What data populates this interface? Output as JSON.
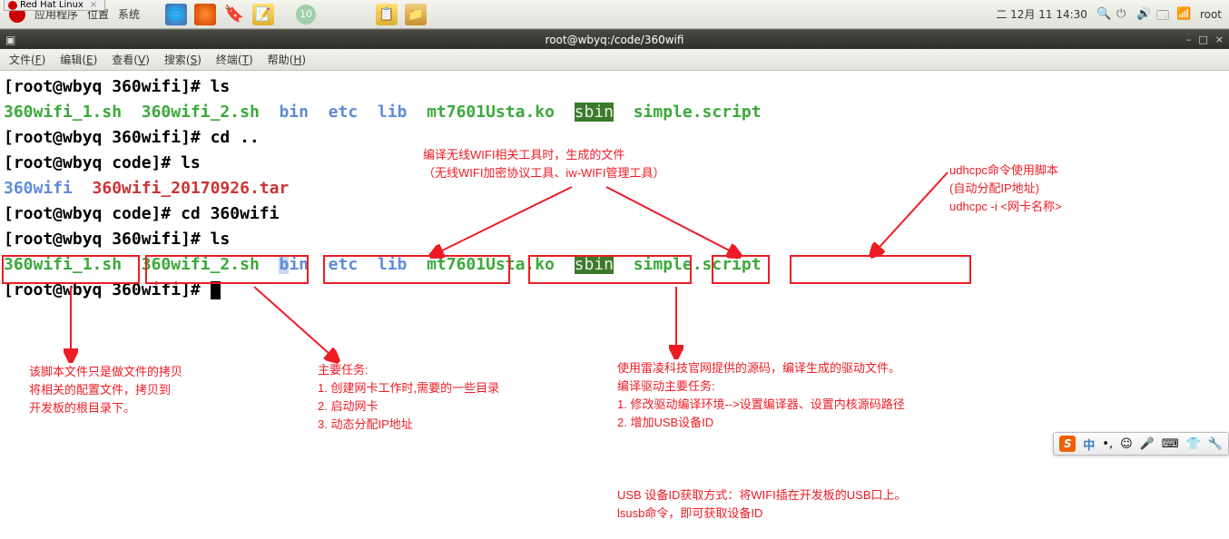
{
  "os_tab": "Red Hat Linux",
  "panel": {
    "apps": "应用程序",
    "places": "位置",
    "system": "系统",
    "badge10": "10",
    "date": "二 12月 11 14:30",
    "user": "root"
  },
  "titlebar": {
    "text": "root@wbyq:/code/360wifi",
    "btn_min": "–",
    "btn_max": "□",
    "btn_close": "×"
  },
  "menubar": {
    "file": "文件",
    "file_k": "F",
    "edit": "编辑",
    "edit_k": "E",
    "view": "查看",
    "view_k": "V",
    "search": "搜索",
    "search_k": "S",
    "terminal": "终端",
    "terminal_k": "T",
    "help": "帮助",
    "help_k": "H"
  },
  "term": {
    "p1": "[root@wbyq 360wifi]# ",
    "cmd1": "ls",
    "out1": {
      "f1": "360wifi_1.sh",
      "f2": "360wifi_2.sh",
      "d1": "bin",
      "d2": "etc",
      "d3": "lib",
      "f3": "mt7601Usta.ko",
      "d4": "sbin",
      "f4": "simple.script"
    },
    "p2": "[root@wbyq 360wifi]# ",
    "cmd2": "cd ..",
    "p3": "[root@wbyq code]# ",
    "cmd3": "ls",
    "out3": {
      "d1": "360wifi",
      "f1": "360wifi_20170926.tar"
    },
    "p4": "[root@wbyq code]# ",
    "cmd4": "cd 360wifi",
    "p5": "[root@wbyq 360wifi]# ",
    "cmd5": "ls",
    "out5": {
      "f1": "360wifi_1.sh",
      "f2": "360wifi_2.sh",
      "b": "b",
      "in": "in",
      "d2": "  etc",
      "d3": "  lib",
      "f3": "mt7601Usta.ko",
      "d4": "sbin",
      "f4": "simple.script"
    },
    "p6": "[root@wbyq 360wifi]# "
  },
  "annos": {
    "wifi_tool": "编译无线WIFI相关工具时，生成的文件\n（无线WIFI加密协议工具、iw-WIFI管理工具）",
    "udhcpc": "udhcpc命令使用脚本\n(自动分配IP地址)\nudhcpc -i <网卡名称>",
    "script1": "该脚本文件只是做文件的拷贝\n将相关的配置文件，拷贝到\n开发板的根目录下。",
    "script2": "主要任务:\n1. 创建网卡工作时,需要的一些目录\n2. 启动网卡\n3. 动态分配IP地址",
    "driver": "使用雷凌科技官网提供的源码，编译生成的驱动文件。\n编译驱动主要任务:\n1. 修改驱动编译环境-->设置编译器、设置内核源码路径\n2. 增加USB设备ID",
    "usbid": "USB 设备ID获取方式：将WIFI插在开发板的USB口上。\nlsusb命令，即可获取设备ID"
  },
  "ime": {
    "s": "S",
    "zh": "中"
  }
}
